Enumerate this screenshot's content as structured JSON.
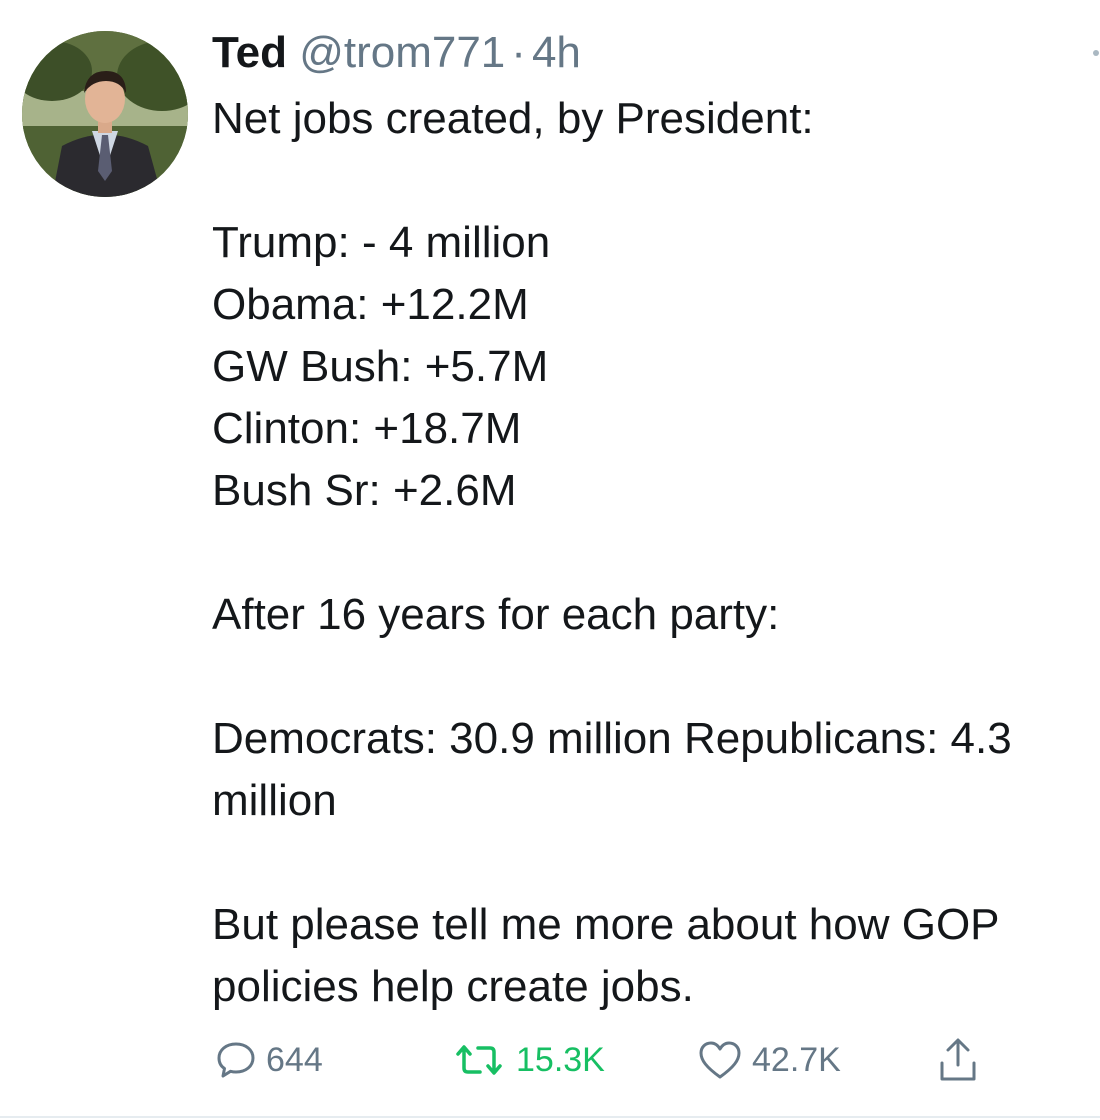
{
  "author": {
    "name": "Ted",
    "handle": "@trom771",
    "separator": "·",
    "time": "4h"
  },
  "tweet": {
    "lines": [
      "Net jobs created, by President:",
      "",
      "Trump: - 4 million",
      "Obama: +12.2M",
      "GW Bush: +5.7M",
      "Clinton: +18.7M",
      "Bush Sr: +2.6M",
      "",
      "After 16 years for each party:",
      "",
      "Democrats: 30.9 million Republicans: 4.3 million",
      "",
      "But please tell me more about how GOP policies help create jobs."
    ]
  },
  "actions": {
    "replies": "644",
    "retweets": "15.3K",
    "likes": "42.7K"
  },
  "icons": {
    "reply": "comment-icon",
    "retweet": "retweet-icon",
    "like": "heart-icon",
    "share": "share-icon",
    "menu": "chevron-down-icon"
  },
  "colors": {
    "text": "#14171a",
    "muted": "#657786",
    "retweet_active": "#17bf63"
  }
}
